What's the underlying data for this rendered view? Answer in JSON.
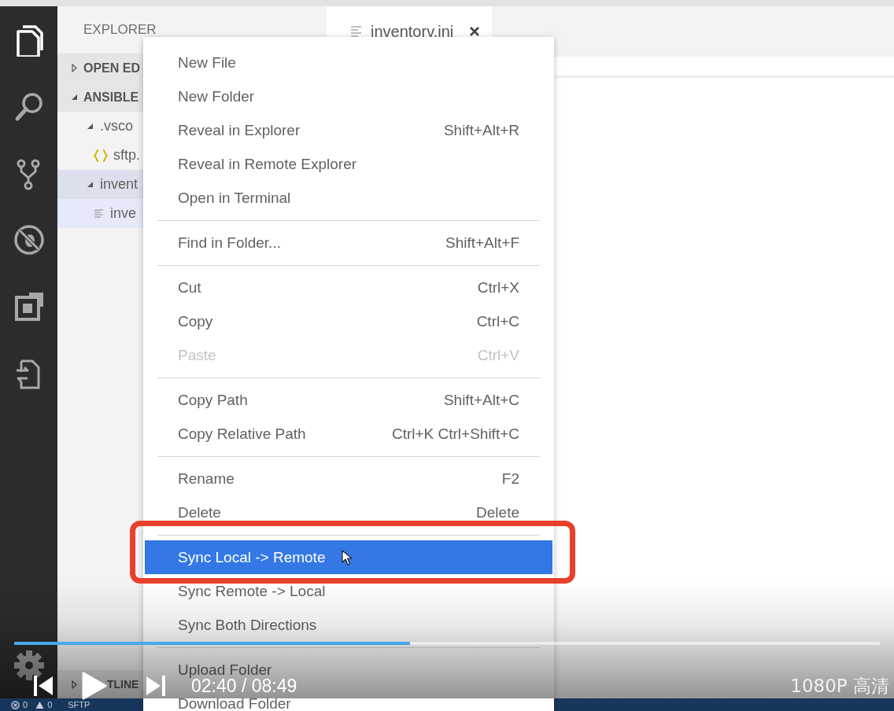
{
  "activity_bar": {
    "items": [
      {
        "kind": "files",
        "selected": true
      },
      {
        "kind": "search",
        "selected": false
      },
      {
        "kind": "branch",
        "selected": false
      },
      {
        "kind": "debug",
        "selected": false
      },
      {
        "kind": "extensions",
        "selected": false
      },
      {
        "kind": "remote",
        "selected": false
      }
    ]
  },
  "sidebar": {
    "title": "EXPLORER",
    "sections": [
      {
        "label": "OPEN ED",
        "expanded": false
      },
      {
        "label": "ANSIBLE",
        "expanded": true,
        "children": [
          {
            "label": ".vsco",
            "kind": "folder",
            "expanded": true,
            "selected": false,
            "hovered": false,
            "children": [
              {
                "label": "sftp.",
                "kind": "json",
                "selected": false,
                "hovered": false
              }
            ]
          },
          {
            "label": "invent",
            "kind": "folder",
            "expanded": true,
            "selected": true,
            "hovered": false,
            "children": [
              {
                "label": "inve",
                "kind": "file",
                "selected": false,
                "hovered": true
              }
            ]
          }
        ]
      }
    ],
    "outline": {
      "label": "TLINE",
      "expanded": false
    }
  },
  "editor": {
    "tabs": [
      {
        "label": "inventorv.ini",
        "selected": true
      }
    ]
  },
  "context_menu": {
    "items": [
      {
        "kind": "item",
        "label": "New File",
        "selected": false,
        "disabled": false
      },
      {
        "kind": "item",
        "label": "New Folder",
        "selected": false,
        "disabled": false
      },
      {
        "kind": "item",
        "label": "Reveal in Explorer",
        "shortcut": "Shift+Alt+R",
        "selected": false,
        "disabled": false
      },
      {
        "kind": "item",
        "label": "Reveal in Remote Explorer",
        "selected": false,
        "disabled": false
      },
      {
        "kind": "item",
        "label": "Open in Terminal",
        "selected": false,
        "disabled": false
      },
      {
        "kind": "separator"
      },
      {
        "kind": "item",
        "label": "Find in Folder...",
        "shortcut": "Shift+Alt+F",
        "selected": false,
        "disabled": false
      },
      {
        "kind": "separator"
      },
      {
        "kind": "item",
        "label": "Cut",
        "shortcut": "Ctrl+X",
        "selected": false,
        "disabled": false
      },
      {
        "kind": "item",
        "label": "Copy",
        "shortcut": "Ctrl+C",
        "selected": false,
        "disabled": false
      },
      {
        "kind": "item",
        "label": "Paste",
        "shortcut": "Ctrl+V",
        "selected": false,
        "disabled": true
      },
      {
        "kind": "separator"
      },
      {
        "kind": "item",
        "label": "Copy Path",
        "shortcut": "Shift+Alt+C",
        "selected": false,
        "disabled": false
      },
      {
        "kind": "item",
        "label": "Copy Relative Path",
        "shortcut": "Ctrl+K Ctrl+Shift+C",
        "selected": false,
        "disabled": false
      },
      {
        "kind": "separator"
      },
      {
        "kind": "item",
        "label": "Rename",
        "shortcut": "F2",
        "selected": false,
        "disabled": false
      },
      {
        "kind": "item",
        "label": "Delete",
        "shortcut": "Delete",
        "selected": false,
        "disabled": false
      },
      {
        "kind": "separator"
      },
      {
        "kind": "item",
        "label": "Sync Local -> Remote",
        "selected": true,
        "disabled": false
      },
      {
        "kind": "item",
        "label": "Sync Remote -> Local",
        "selected": false,
        "disabled": false
      },
      {
        "kind": "item",
        "label": "Sync Both Directions",
        "selected": false,
        "disabled": false
      },
      {
        "kind": "separator"
      },
      {
        "kind": "item",
        "label": "Upload Folder",
        "selected": false,
        "disabled": false
      },
      {
        "kind": "item",
        "label": "Download Folder",
        "selected": false,
        "disabled": false
      }
    ]
  },
  "status_bar": {
    "errors": "0",
    "warnings": "0",
    "label": "SFTP"
  },
  "player": {
    "progress": {
      "level": 0.457
    },
    "time": "02:40 / 08:49",
    "quality": "1080P 高清"
  }
}
